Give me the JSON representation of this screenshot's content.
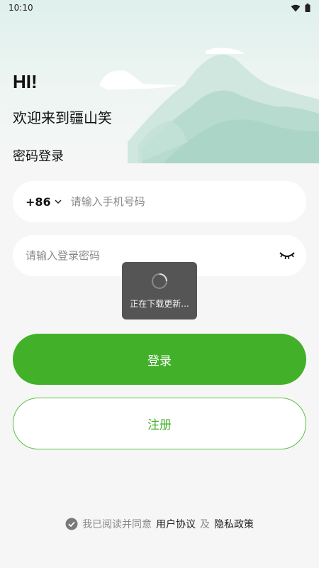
{
  "status_bar": {
    "time": "10:10",
    "wifi_icon": "wifi-icon",
    "battery_icon": "battery-icon"
  },
  "header": {
    "greeting": "HI!",
    "welcome": "欢迎来到疆山笑"
  },
  "login_mode_title": "密码登录",
  "phone_field": {
    "country_code": "+86",
    "placeholder": "请输入手机号码",
    "value": ""
  },
  "password_field": {
    "placeholder": "请输入登录密码",
    "value": "",
    "toggle_icon": "eye-closed-icon"
  },
  "toast": {
    "text": "正在下载更新..."
  },
  "buttons": {
    "login": "登录",
    "register": "注册"
  },
  "agreement": {
    "prefix": "我已阅读并同意",
    "user_agreement": "用户协议",
    "and": "及",
    "privacy_policy": "隐私政策"
  },
  "colors": {
    "accent": "#43b02a",
    "background": "#f5f6f5"
  }
}
